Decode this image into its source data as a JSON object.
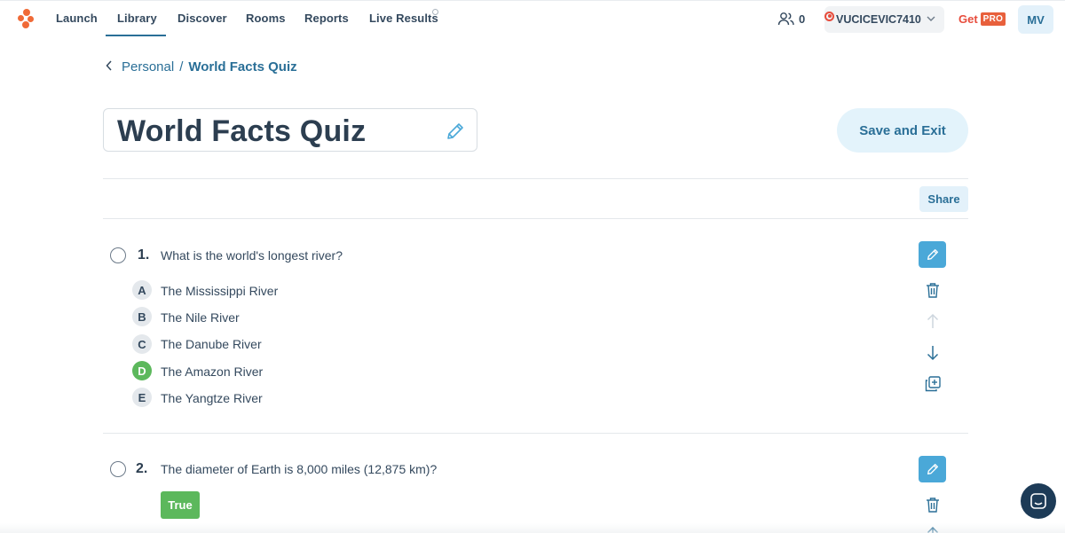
{
  "nav": {
    "items": [
      {
        "label": "Launch"
      },
      {
        "label": "Library"
      },
      {
        "label": "Discover"
      },
      {
        "label": "Rooms"
      },
      {
        "label": "Reports"
      },
      {
        "label": "Live Results"
      }
    ],
    "active": "Library",
    "students_count": "0",
    "username": "VUCICEVIC7410",
    "get_label": "Get",
    "pro_label": "PRO",
    "avatar_initials": "MV"
  },
  "breadcrumb": {
    "parent": "Personal",
    "separator": "/",
    "current": "World Facts Quiz"
  },
  "quiz": {
    "title": "World Facts Quiz",
    "save_exit_label": "Save and Exit",
    "share_label": "Share"
  },
  "questions": [
    {
      "number": "1.",
      "text": "What is the world's longest river?",
      "options": [
        {
          "letter": "A",
          "text": "The Mississippi River",
          "correct": false
        },
        {
          "letter": "B",
          "text": "The Nile River",
          "correct": false
        },
        {
          "letter": "C",
          "text": "The Danube River",
          "correct": false
        },
        {
          "letter": "D",
          "text": "The Amazon River",
          "correct": true
        },
        {
          "letter": "E",
          "text": "The Yangtze River",
          "correct": false
        }
      ]
    },
    {
      "number": "2.",
      "text": "The diameter of Earth is 8,000 miles (12,875 km)?",
      "answer": "True"
    }
  ],
  "colors": {
    "accent": "#2a6f97",
    "correct": "#5cb85c",
    "brand_orange": "#f06a37",
    "edit_button": "#4aa8d8"
  },
  "icons": [
    "logo-icon",
    "people-icon",
    "record-icon",
    "chevron-down-icon",
    "back-chevron-icon",
    "pencil-icon",
    "trash-icon",
    "arrow-up-icon",
    "arrow-down-icon",
    "duplicate-icon",
    "chat-icon"
  ]
}
